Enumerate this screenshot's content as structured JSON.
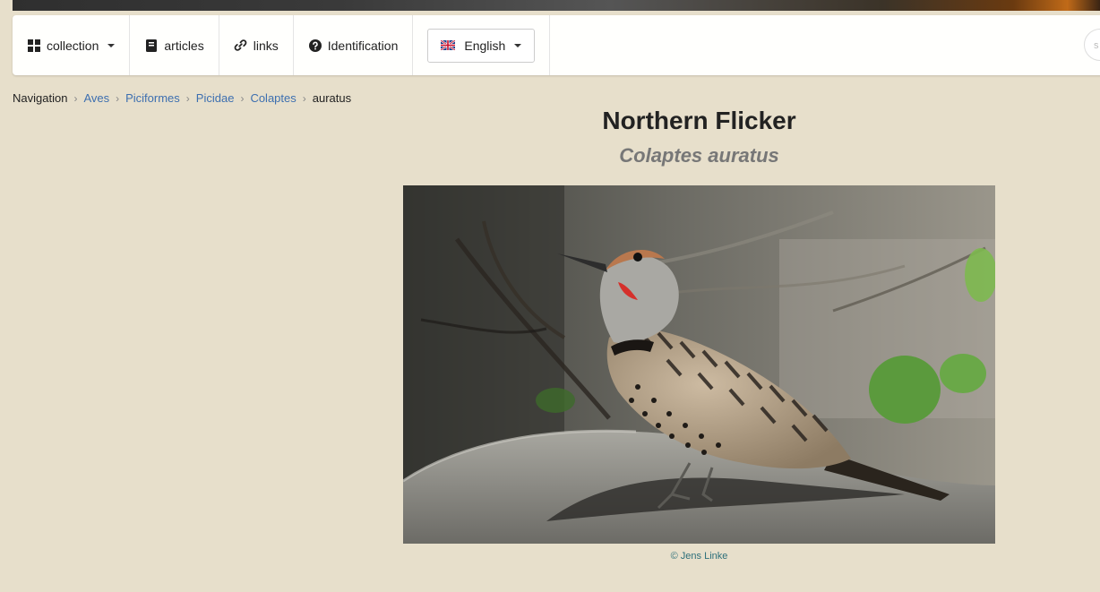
{
  "navbar": {
    "collection_label": "collection",
    "articles_label": "articles",
    "links_label": "links",
    "identification_label": "Identification",
    "language_label": "English",
    "search_placeholder": "s"
  },
  "breadcrumb": {
    "root": "Navigation",
    "items": [
      "Aves",
      "Piciformes",
      "Picidae",
      "Colaptes"
    ],
    "current": "auratus"
  },
  "species": {
    "common_name": "Northern Flicker",
    "scientific_name": "Colaptes auratus"
  },
  "photo": {
    "credit": "© Jens Linke"
  },
  "colors": {
    "page_bg": "#e7dfcb",
    "link": "#3d6fb0",
    "credit": "#2d6f7a"
  },
  "icons": [
    "grid-icon",
    "book-icon",
    "link-icon",
    "question-circle-icon",
    "uk-flag-icon",
    "chevron-right-icon",
    "caret-down-icon"
  ]
}
